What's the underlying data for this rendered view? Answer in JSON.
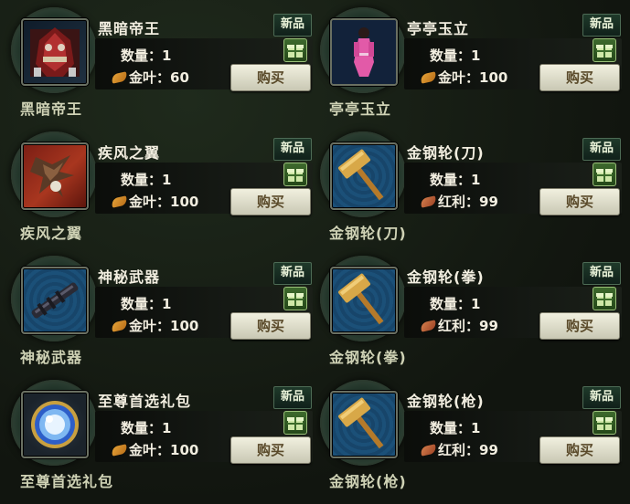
{
  "labels": {
    "new_badge": "新品",
    "quantity_prefix": "数量：",
    "buy_button": "购买"
  },
  "items": [
    {
      "name": "黑暗帝王",
      "quantity": "1",
      "currency": "金叶：",
      "price": "60",
      "caption": "黑暗帝王",
      "icon": "dark-emperor-mount-icon"
    },
    {
      "name": "亭亭玉立",
      "quantity": "1",
      "currency": "金叶：",
      "price": "100",
      "caption": "亭亭玉立",
      "icon": "pink-dress-outfit-icon"
    },
    {
      "name": "疾风之翼",
      "quantity": "1",
      "currency": "金叶：",
      "price": "100",
      "caption": "疾风之翼",
      "icon": "eagle-wing-icon"
    },
    {
      "name": "金钢轮(刀)",
      "quantity": "1",
      "currency": "红利：",
      "price": "99",
      "caption": "金钢轮(刀)",
      "icon": "golden-hammer-icon"
    },
    {
      "name": "神秘武器",
      "quantity": "1",
      "currency": "金叶：",
      "price": "100",
      "caption": "神秘武器",
      "icon": "mystery-weapon-icon"
    },
    {
      "name": "金钢轮(拳)",
      "quantity": "1",
      "currency": "红利：",
      "price": "99",
      "caption": "金钢轮(拳)",
      "icon": "golden-hammer-icon"
    },
    {
      "name": "至尊首选礼包",
      "quantity": "1",
      "currency": "金叶：",
      "price": "100",
      "caption": "至尊首选礼包",
      "icon": "blue-orb-gift-icon"
    },
    {
      "name": "金钢轮(枪)",
      "quantity": "1",
      "currency": "红利：",
      "price": "99",
      "caption": "金钢轮(枪)",
      "icon": "golden-hammer-icon"
    }
  ]
}
